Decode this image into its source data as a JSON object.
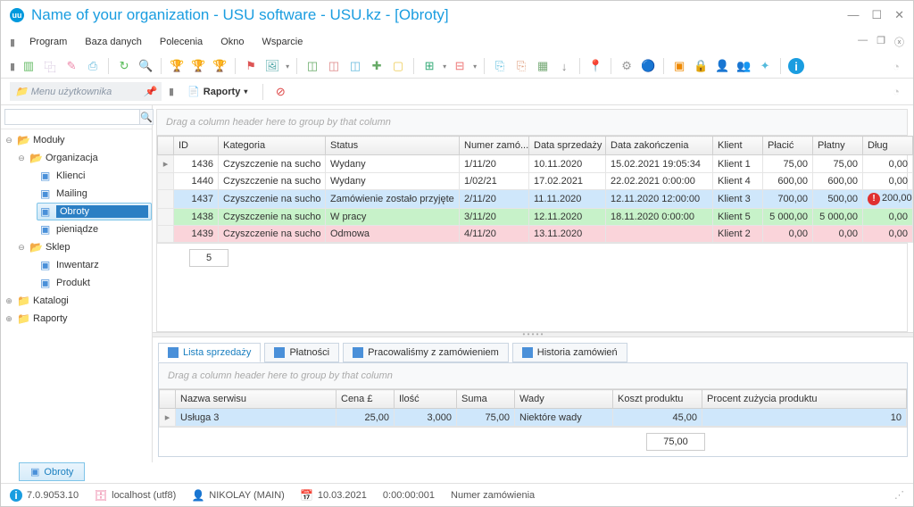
{
  "title": "Name of your organization - USU software - USU.kz - [Obroty]",
  "menu": {
    "program": "Program",
    "baza": "Baza danych",
    "polecenia": "Polecenia",
    "okno": "Okno",
    "wsparcie": "Wsparcie"
  },
  "sidebar_header": "Menu użytkownika",
  "reports_label": "Raporty",
  "tree": {
    "moduly": "Moduły",
    "organizacja": "Organizacja",
    "klienci": "Klienci",
    "mailing": "Mailing",
    "obroty": "Obroty",
    "pieniadze": "pieniądze",
    "sklep": "Sklep",
    "inwentarz": "Inwentarz",
    "produkt": "Produkt",
    "katalogi": "Katalogi",
    "raporty": "Raporty"
  },
  "group_hint": "Drag a column header here to group by that column",
  "grid": {
    "headers": {
      "id": "ID",
      "kategoria": "Kategoria",
      "status": "Status",
      "numer": "Numer zamó...",
      "data_sprz": "Data sprzedaży",
      "data_zak": "Data zakończenia",
      "klient": "Klient",
      "placic": "Płacić",
      "platny": "Płatny",
      "dlug": "Dług"
    },
    "rows": [
      {
        "id": "1436",
        "kat": "Czyszczenie na sucho",
        "status": "Wydany",
        "numer": "1/11/20",
        "ds": "10.11.2020",
        "dz": "15.02.2021 19:05:34",
        "klient": "Klient 1",
        "placic": "75,00",
        "platny": "75,00",
        "dlug": "0,00",
        "cls": ""
      },
      {
        "id": "1440",
        "kat": "Czyszczenie na sucho",
        "status": "Wydany",
        "numer": "1/02/21",
        "ds": "17.02.2021",
        "dz": "22.02.2021 0:00:00",
        "klient": "Klient 4",
        "placic": "600,00",
        "platny": "600,00",
        "dlug": "0,00",
        "cls": ""
      },
      {
        "id": "1437",
        "kat": "Czyszczenie na sucho",
        "status": "Zamówienie zostało przyjęte",
        "numer": "2/11/20",
        "ds": "11.11.2020",
        "dz": "12.11.2020 12:00:00",
        "klient": "Klient 3",
        "placic": "700,00",
        "platny": "500,00",
        "dlug": "200,00",
        "cls": "row-blue",
        "alert": true
      },
      {
        "id": "1438",
        "kat": "Czyszczenie na sucho",
        "status": "W pracy",
        "numer": "3/11/20",
        "ds": "12.11.2020",
        "dz": "18.11.2020 0:00:00",
        "klient": "Klient 5",
        "placic": "5 000,00",
        "platny": "5 000,00",
        "dlug": "0,00",
        "cls": "row-green"
      },
      {
        "id": "1439",
        "kat": "Czyszczenie na sucho",
        "status": "Odmowa",
        "numer": "4/11/20",
        "ds": "13.11.2020",
        "dz": "",
        "klient": "Klient 2",
        "placic": "0,00",
        "platny": "0,00",
        "dlug": "0,00",
        "cls": "row-pink"
      }
    ],
    "footer_count": "5"
  },
  "subtabs": {
    "lista": "Lista sprzedaży",
    "platnosci": "Płatności",
    "pracowalismy": "Pracowaliśmy z zamówieniem",
    "historia": "Historia zamówień"
  },
  "subgrid": {
    "headers": {
      "nazwa": "Nazwa serwisu",
      "cena": "Cena £",
      "ilosc": "Ilość",
      "suma": "Suma",
      "wady": "Wady",
      "koszt": "Koszt produktu",
      "procent": "Procent zużycia produktu"
    },
    "row": {
      "nazwa": "Usługa 3",
      "cena": "25,00",
      "ilosc": "3,000",
      "suma": "75,00",
      "wady": "Niektóre wady",
      "koszt": "45,00",
      "procent": "10"
    },
    "footer_sum": "75,00"
  },
  "bottom_tab": "Obroty",
  "status": {
    "version": "7.0.9053.10",
    "host": "localhost (utf8)",
    "user": "NIKOLAY (MAIN)",
    "date": "10.03.2021",
    "time": "0:00:00:001",
    "order": "Numer zamówienia"
  }
}
